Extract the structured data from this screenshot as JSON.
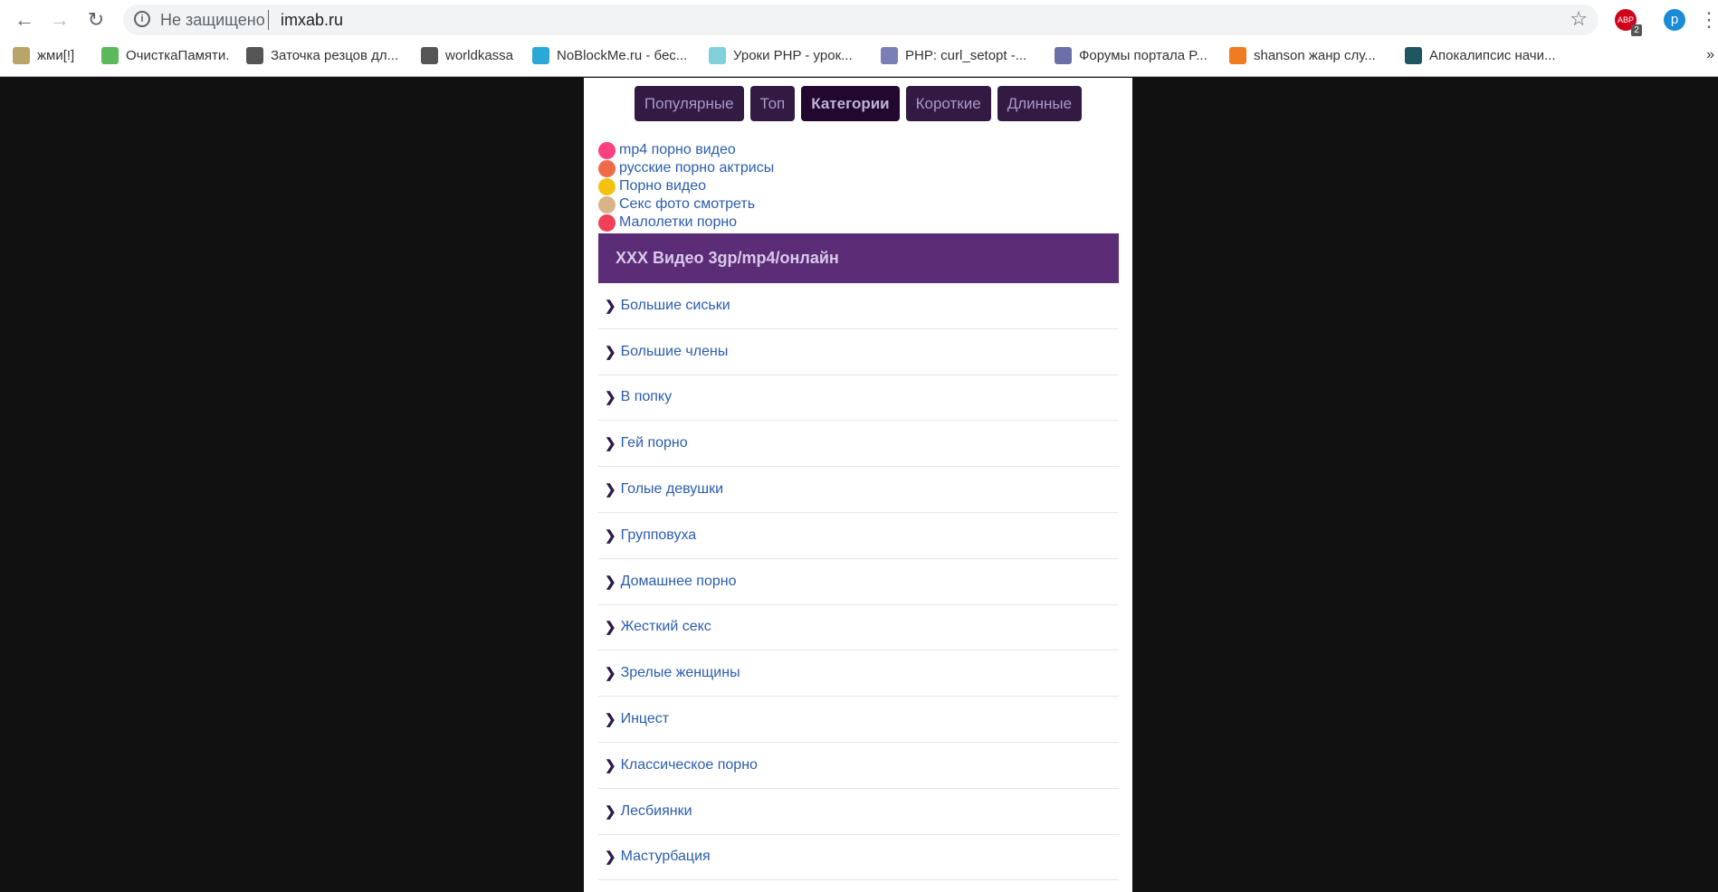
{
  "browser": {
    "security_label": "Не защищено",
    "url": "imxab.ru",
    "profile_initial": "p",
    "abp_label": "ABP",
    "abp_count": "2",
    "overflow": "»",
    "bookmarks": [
      {
        "label": "жми[!]",
        "icon": "exclamation-icon",
        "color": "#b9a46a"
      },
      {
        "label": "ОчисткаПамяти.",
        "icon": "user-icon",
        "color": "#5cb85c"
      },
      {
        "label": "Заточка резцов дл...",
        "icon": "wrench-icon",
        "color": "#555"
      },
      {
        "label": "worldkassa",
        "icon": "globe-icon",
        "color": "#555"
      },
      {
        "label": "NoBlockMe.ru - бес...",
        "icon": "nb-icon",
        "color": "#2aa9d8"
      },
      {
        "label": "Уроки PHP - урок...",
        "icon": "drop-icon",
        "color": "#7fd0d8"
      },
      {
        "label": "PHP: curl_setopt -...",
        "icon": "php-icon",
        "color": "#7a7fb8"
      },
      {
        "label": "Форумы портала P...",
        "icon": "php-oval-icon",
        "color": "#6b70a8"
      },
      {
        "label": "shanson жанр слу...",
        "icon": "headphones-icon",
        "color": "#f07b20"
      },
      {
        "label": "Апокалипсис начи...",
        "icon": "play-icon",
        "color": "#1f5560"
      }
    ]
  },
  "nav": {
    "tabs": [
      {
        "label": "Популярные"
      },
      {
        "label": "Топ"
      },
      {
        "label": "Категории",
        "active": true
      },
      {
        "label": "Короткие"
      },
      {
        "label": "Длинные"
      }
    ]
  },
  "promo_links": [
    {
      "label": "mp4 порно видео",
      "icon": "play-circle-icon",
      "color": "#ff3f7f"
    },
    {
      "label": "русские порно актрисы",
      "icon": "gender-icon",
      "color": "#f06a4a"
    },
    {
      "label": "Порно видео",
      "icon": "scream-emoji-icon",
      "color": "#f4c20d"
    },
    {
      "label": "Секс фото смотреть",
      "icon": "face-photo-icon",
      "color": "#d8b38a"
    },
    {
      "label": "Малолетки порно",
      "icon": "lips-icon",
      "color": "#f0405a"
    }
  ],
  "section": {
    "title": "XXX Видео 3gp/mp4/онлайн"
  },
  "categories": [
    "Большие сиськи",
    "Большие члены",
    "В попку",
    "Гей порно",
    "Голые девушки",
    "Групповуха",
    "Домашнее порно",
    "Жесткий секс",
    "Зрелые женщины",
    "Инцест",
    "Классическое порно",
    "Лесбиянки",
    "Мастурбация"
  ],
  "colors": {
    "header": "#5b2d76",
    "tab": "#321a42",
    "link": "#2a5db0"
  }
}
